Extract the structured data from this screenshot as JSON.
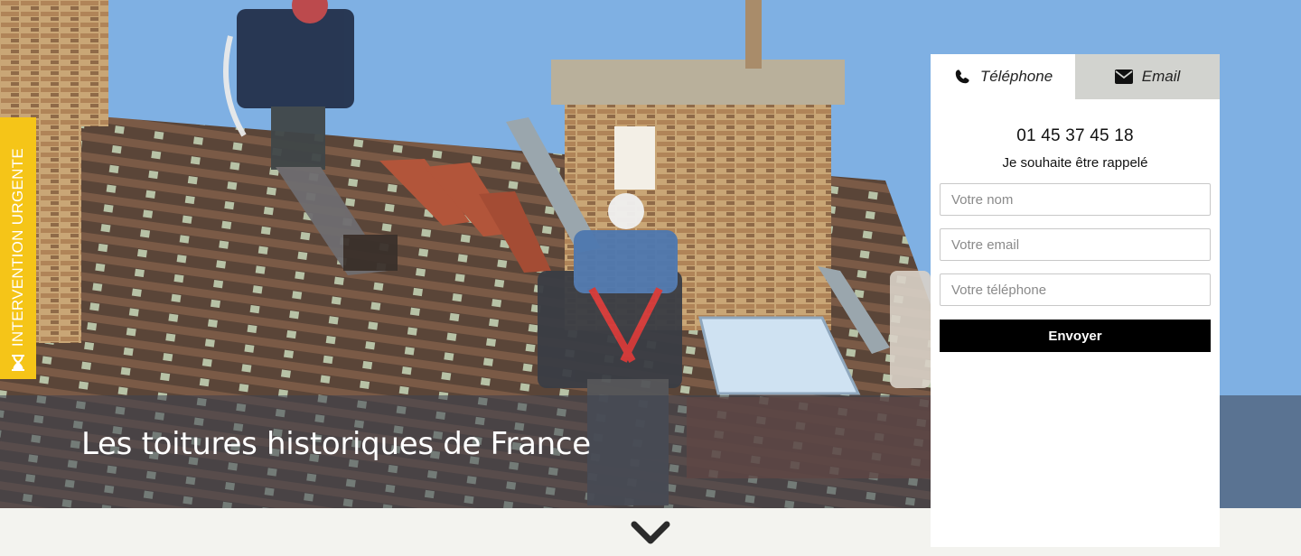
{
  "hero": {
    "caption": "Les toitures historiques de France",
    "sky_color": "#7fb0e3",
    "band_color": "#3c4250"
  },
  "urgent_tab": {
    "label": "INTERVENTION URGENTE",
    "icon": "hourglass-icon",
    "color": "#f5c518"
  },
  "contact_panel": {
    "tabs": [
      {
        "label": "Téléphone",
        "icon": "phone-icon",
        "active": true
      },
      {
        "label": "Email",
        "icon": "envelope-icon",
        "active": false
      }
    ],
    "phone_number": "01 45 37 45 18",
    "callback_text": "Je souhaite être rappelé",
    "fields": {
      "name_placeholder": "Votre nom",
      "email_placeholder": "Votre email",
      "phone_placeholder": "Votre téléphone"
    },
    "submit_label": "Envoyer"
  },
  "scroll_down": {
    "icon": "chevron-down-icon"
  }
}
